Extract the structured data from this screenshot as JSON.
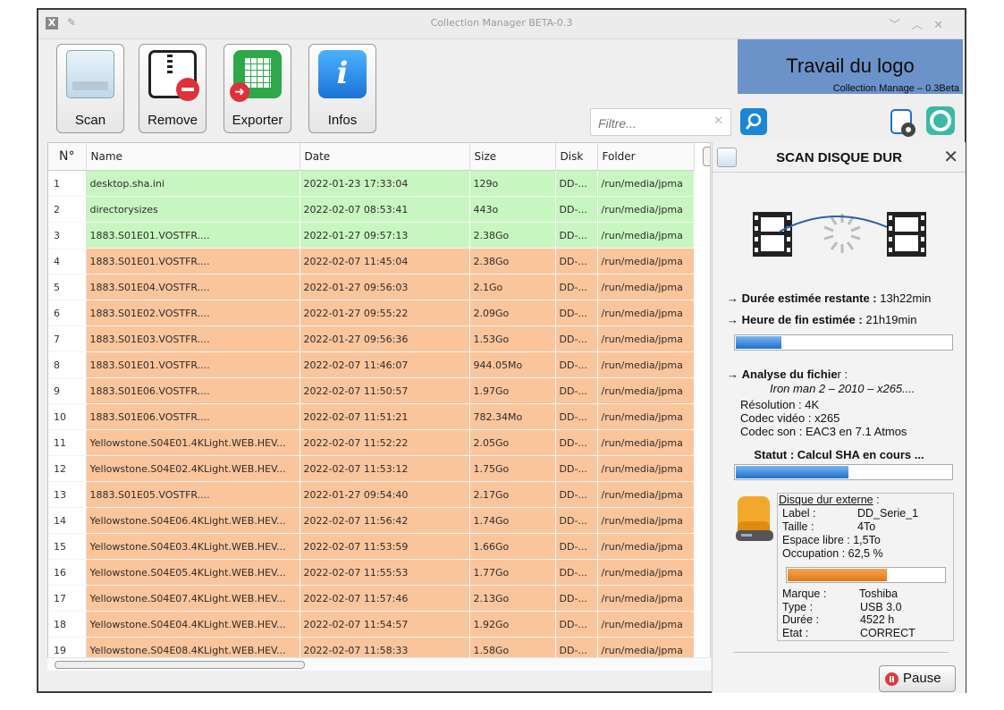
{
  "window": {
    "title": "Collection Manager BETA-0.3",
    "controls": [
      "﹀",
      "︿",
      "✕"
    ]
  },
  "toolbar": {
    "scan_label": "Scan",
    "remove_label": "Remove",
    "export_label": "Exporter",
    "info_label": "Infos"
  },
  "logo": {
    "title": "Travail du logo",
    "subtitle": "Collection Manage – 0.3Beta"
  },
  "filter": {
    "placeholder": "Filtre...",
    "value": ""
  },
  "table": {
    "columns": [
      "N°",
      "Name",
      "Date",
      "Size",
      "Disk",
      "Folder"
    ],
    "rows": [
      {
        "n": "1",
        "name": "desktop.sha.ini",
        "date": "2022-01-23 17:33:04",
        "size": "129o",
        "disk": "DD-...",
        "folder": "/run/media/jpma",
        "status": "green"
      },
      {
        "n": "2",
        "name": "directorysizes",
        "date": "2022-02-07 08:53:41",
        "size": "443o",
        "disk": "DD-...",
        "folder": "/run/media/jpma",
        "status": "green"
      },
      {
        "n": "3",
        "name": "1883.S01E01.VOSTFR....",
        "date": "2022-01-27 09:57:13",
        "size": "2.38Go",
        "disk": "DD-...",
        "folder": "/run/media/jpma",
        "status": "green"
      },
      {
        "n": "4",
        "name": "1883.S01E01.VOSTFR....",
        "date": "2022-02-07 11:45:04",
        "size": "2.38Go",
        "disk": "DD-...",
        "folder": "/run/media/jpma",
        "status": "orange"
      },
      {
        "n": "5",
        "name": "1883.S01E04.VOSTFR....",
        "date": "2022-01-27 09:56:03",
        "size": "2.1Go",
        "disk": "DD-...",
        "folder": "/run/media/jpma",
        "status": "orange"
      },
      {
        "n": "6",
        "name": "1883.S01E02.VOSTFR....",
        "date": "2022-01-27 09:55:22",
        "size": "2.09Go",
        "disk": "DD-...",
        "folder": "/run/media/jpma",
        "status": "orange"
      },
      {
        "n": "7",
        "name": "1883.S01E03.VOSTFR....",
        "date": "2022-01-27 09:56:36",
        "size": "1.53Go",
        "disk": "DD-...",
        "folder": "/run/media/jpma",
        "status": "orange"
      },
      {
        "n": "8",
        "name": "1883.S01E01.VOSTFR....",
        "date": "2022-02-07 11:46:07",
        "size": "944.05Mo",
        "disk": "DD-...",
        "folder": "/run/media/jpma",
        "status": "orange"
      },
      {
        "n": "9",
        "name": "1883.S01E06.VOSTFR....",
        "date": "2022-02-07 11:50:57",
        "size": "1.97Go",
        "disk": "DD-...",
        "folder": "/run/media/jpma",
        "status": "orange"
      },
      {
        "n": "10",
        "name": "1883.S01E06.VOSTFR....",
        "date": "2022-02-07 11:51:21",
        "size": "782.34Mo",
        "disk": "DD-...",
        "folder": "/run/media/jpma",
        "status": "orange"
      },
      {
        "n": "11",
        "name": "Yellowstone.S04E01.4KLight.WEB.HEV...",
        "date": "2022-02-07 11:52:22",
        "size": "2.05Go",
        "disk": "DD-...",
        "folder": "/run/media/jpma",
        "status": "orange"
      },
      {
        "n": "12",
        "name": "Yellowstone.S04E02.4KLight.WEB.HEV...",
        "date": "2022-02-07 11:53:12",
        "size": "1.75Go",
        "disk": "DD-...",
        "folder": "/run/media/jpma",
        "status": "orange"
      },
      {
        "n": "13",
        "name": "1883.S01E05.VOSTFR....",
        "date": "2022-01-27 09:54:40",
        "size": "2.17Go",
        "disk": "DD-...",
        "folder": "/run/media/jpma",
        "status": "orange"
      },
      {
        "n": "14",
        "name": "Yellowstone.S04E06.4KLight.WEB.HEV...",
        "date": "2022-02-07 11:56:42",
        "size": "1.74Go",
        "disk": "DD-...",
        "folder": "/run/media/jpma",
        "status": "orange"
      },
      {
        "n": "15",
        "name": "Yellowstone.S04E03.4KLight.WEB.HEV...",
        "date": "2022-02-07 11:53:59",
        "size": "1.66Go",
        "disk": "DD-...",
        "folder": "/run/media/jpma",
        "status": "orange"
      },
      {
        "n": "16",
        "name": "Yellowstone.S04E05.4KLight.WEB.HEV...",
        "date": "2022-02-07 11:55:53",
        "size": "1.77Go",
        "disk": "DD-...",
        "folder": "/run/media/jpma",
        "status": "orange"
      },
      {
        "n": "17",
        "name": "Yellowstone.S04E07.4KLight.WEB.HEV...",
        "date": "2022-02-07 11:57:46",
        "size": "2.13Go",
        "disk": "DD-...",
        "folder": "/run/media/jpma",
        "status": "orange"
      },
      {
        "n": "18",
        "name": "Yellowstone.S04E04.4KLight.WEB.HEV...",
        "date": "2022-02-07 11:54:57",
        "size": "1.92Go",
        "disk": "DD-...",
        "folder": "/run/media/jpma",
        "status": "orange"
      },
      {
        "n": "19",
        "name": "Yellowstone.S04E08.4KLight.WEB.HEV...",
        "date": "2022-02-07 11:58:33",
        "size": "1.58Go",
        "disk": "DD-...",
        "folder": "/run/media/jpma",
        "status": "orange"
      }
    ]
  },
  "colors": {
    "row_green": "#c8f6c0",
    "row_orange": "#fbc59c",
    "accent": "#1a86d8"
  },
  "scan": {
    "title": "SCAN DISQUE DUR",
    "remaining_label": "Durée estimée restante :",
    "remaining_value": "13h22min",
    "end_label": "Heure de fin estimée :",
    "end_value": "21h19min",
    "progress_fraction": 0.21,
    "analyse_label": "Analyse du fichie",
    "analyse_suffix": "r :",
    "file": "Iron man 2 – 2010 – x265....",
    "resolution": "Résolution : 4K",
    "video_codec": "Codec vidéo : x265",
    "audio_codec": "Codec son : EAC3 en 7.1 Atmos",
    "status": "Statut : Calcul SHA en cours ...",
    "sha_fraction": 0.52,
    "pause_label": "Pause"
  },
  "disk": {
    "heading": "Disque dur externe",
    "heading_suffix": " :",
    "label_key": "Label :",
    "label_val": "DD_Serie_1",
    "size_key": "Taille :",
    "size_val": "4To",
    "free": "Espace libre : 1,5To",
    "occ": "Occupation :   62,5 %",
    "occupation_fraction": 0.625,
    "brand_key": "Marque :",
    "brand_val": "Toshiba",
    "type_key": "Type :",
    "type_val": "USB 3.0",
    "dur_key": "Durée :",
    "dur_val": "4522 h",
    "state_key": "Etat :",
    "state_val": "CORRECT"
  }
}
